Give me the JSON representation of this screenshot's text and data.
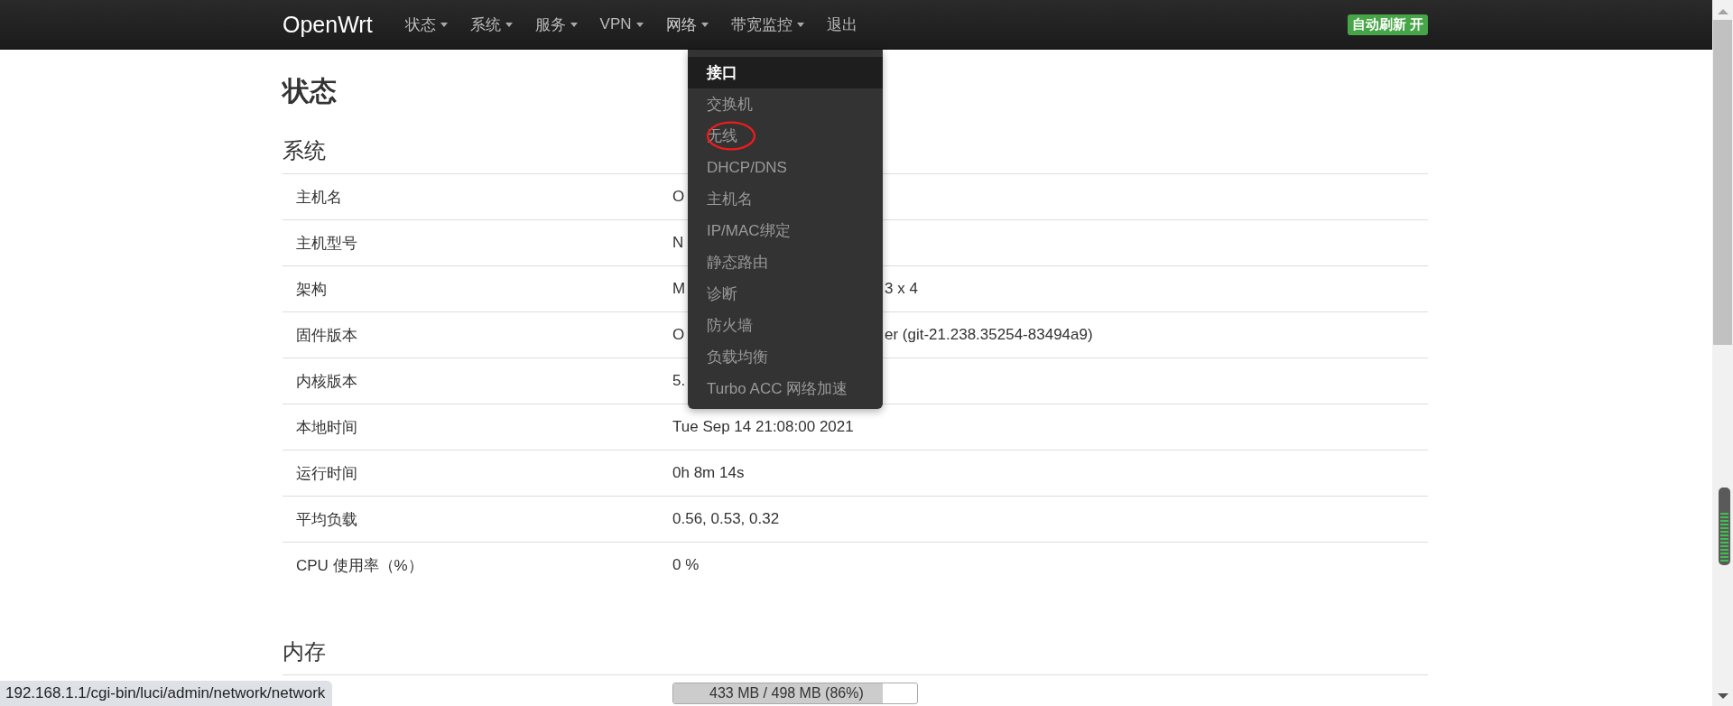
{
  "navbar": {
    "brand": "OpenWrt",
    "menus": [
      {
        "label": "状态",
        "dropdown": true,
        "open": false
      },
      {
        "label": "系统",
        "dropdown": true,
        "open": false
      },
      {
        "label": "服务",
        "dropdown": true,
        "open": false
      },
      {
        "label": "VPN",
        "dropdown": true,
        "open": false
      },
      {
        "label": "网络",
        "dropdown": true,
        "open": true
      },
      {
        "label": "带宽监控",
        "dropdown": true,
        "open": false
      },
      {
        "label": "退出",
        "dropdown": false,
        "open": false
      }
    ],
    "auto_refresh": {
      "label": "自动刷新 开",
      "on": true
    }
  },
  "open_menu": {
    "items": [
      {
        "label": "接口",
        "selected": true,
        "circled": false
      },
      {
        "label": "交换机",
        "selected": false,
        "circled": false
      },
      {
        "label": "无线",
        "selected": false,
        "circled": true
      },
      {
        "label": "DHCP/DNS",
        "selected": false,
        "circled": false
      },
      {
        "label": "主机名",
        "selected": false,
        "circled": false
      },
      {
        "label": "IP/MAC绑定",
        "selected": false,
        "circled": false
      },
      {
        "label": "静态路由",
        "selected": false,
        "circled": false
      },
      {
        "label": "诊断",
        "selected": false,
        "circled": false
      },
      {
        "label": "防火墙",
        "selected": false,
        "circled": false
      },
      {
        "label": "负载均衡",
        "selected": false,
        "circled": false
      },
      {
        "label": "Turbo ACC 网络加速",
        "selected": false,
        "circled": false
      }
    ]
  },
  "page_title": "状态",
  "sections": [
    {
      "title": "系统",
      "rows": [
        {
          "kind": "text",
          "label": "主机名",
          "value": "O"
        },
        {
          "kind": "text",
          "label": "主机型号",
          "value": "N"
        },
        {
          "kind": "text",
          "label": "架构",
          "value": "M",
          "value_tail": "3 x 4"
        },
        {
          "kind": "text",
          "label": "固件版本",
          "value": "O",
          "value_tail": "er (git-21.238.35254-83494a9)"
        },
        {
          "kind": "text",
          "label": "内核版本",
          "value": "5."
        },
        {
          "kind": "text",
          "label": "本地时间",
          "value": "Tue Sep 14 21:08:00 2021"
        },
        {
          "kind": "text",
          "label": "运行时间",
          "value": "0h 8m 14s"
        },
        {
          "kind": "text",
          "label": "平均负载",
          "value": "0.56, 0.53, 0.32"
        },
        {
          "kind": "text",
          "label": "CPU 使用率（%）",
          "value": "0 %"
        }
      ]
    },
    {
      "title": "内存",
      "rows": [
        {
          "kind": "progress",
          "level": 0.86,
          "reading": "433 MB / 498 MB (86%)"
        }
      ]
    }
  ],
  "status_bar": {
    "url": "192.168.1.1/cgi-bin/luci/admin/network/network"
  }
}
